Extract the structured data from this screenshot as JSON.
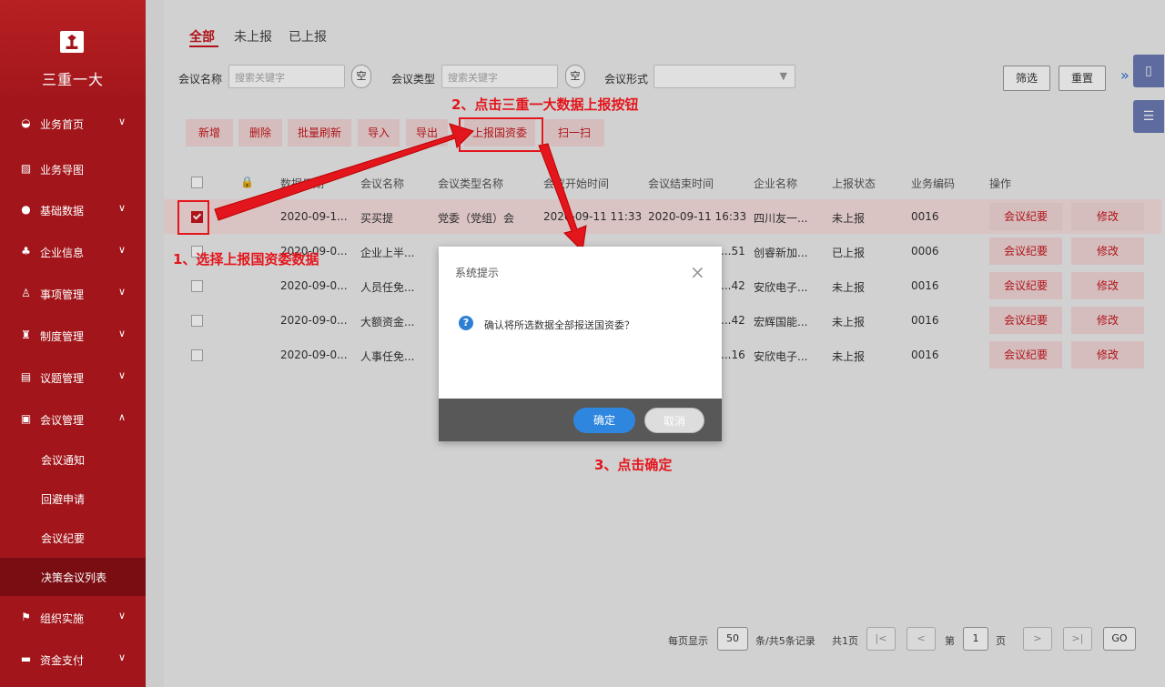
{
  "sidebar": {
    "logo_text": "三重一大",
    "items": [
      {
        "label": "业务首页",
        "chevron": "∨"
      },
      {
        "label": "业务导图",
        "chevron": ""
      },
      {
        "label": "基础数据",
        "chevron": "∨"
      },
      {
        "label": "企业信息",
        "chevron": "∨"
      },
      {
        "label": "事项管理",
        "chevron": "∨"
      },
      {
        "label": "制度管理",
        "chevron": "∨"
      },
      {
        "label": "议题管理",
        "chevron": "∨"
      },
      {
        "label": "会议管理",
        "chevron": "∧"
      },
      {
        "label": "组织实施",
        "chevron": "∨"
      },
      {
        "label": "资金支付",
        "chevron": "∨"
      }
    ],
    "subitems": [
      {
        "label": "会议通知"
      },
      {
        "label": "回避申请"
      },
      {
        "label": "会议纪要"
      },
      {
        "label": "决策会议列表"
      }
    ]
  },
  "tabs": [
    {
      "label": "全部"
    },
    {
      "label": "未上报"
    },
    {
      "label": "已上报"
    }
  ],
  "filters": {
    "meeting_name_label": "会议名称",
    "meeting_name_placeholder": "搜索关键字",
    "meeting_type_label": "会议类型",
    "meeting_type_placeholder": "搜索关键字",
    "meeting_form_label": "会议形式",
    "clear_label": "空",
    "filter_button": "筛选",
    "reset_button": "重置",
    "expand_icon": "»"
  },
  "actions": [
    "新增",
    "删除",
    "批量刷新",
    "导入",
    "导出",
    "上报国资委",
    "扫一扫"
  ],
  "table": {
    "headers": [
      "数据日期",
      "会议名称",
      "会议类型名称",
      "会议开始时间",
      "会议结束时间",
      "企业名称",
      "上报状态",
      "业务编码",
      "操作"
    ],
    "rows": [
      {
        "date": "2020-09-1...",
        "name": "买买提",
        "type": "党委（党组）会",
        "start": "2020-09-11 11:33",
        "end": "2020-09-11 16:33",
        "company": "四川友一...",
        "status": "未上报",
        "code": "0016",
        "checked": true
      },
      {
        "date": "2020-09-0...",
        "name": "企业上半...",
        "type": "",
        "start": "",
        "end": "...51",
        "company": "创睿新加...",
        "status": "已上报",
        "code": "0006",
        "checked": false
      },
      {
        "date": "2020-09-0...",
        "name": "人员任免...",
        "type": "",
        "start": "",
        "end": "...42",
        "company": "安欣电子...",
        "status": "未上报",
        "code": "0016",
        "checked": false
      },
      {
        "date": "2020-09-0...",
        "name": "大额资金...",
        "type": "",
        "start": "",
        "end": "...42",
        "company": "宏辉国能...",
        "status": "未上报",
        "code": "0016",
        "checked": false
      },
      {
        "date": "2020-09-0...",
        "name": "人事任免...",
        "type": "",
        "start": "",
        "end": "...16",
        "company": "安欣电子...",
        "status": "未上报",
        "code": "0016",
        "checked": false
      }
    ],
    "row_actions": [
      "会议纪要",
      "修改"
    ]
  },
  "dialog": {
    "title": "系统提示",
    "message": "确认将所选数据全部报送国资委？",
    "ok": "确定",
    "cancel": "取消",
    "close": "×"
  },
  "annotations": {
    "step1": "1、选择上报国资委数据",
    "step2": "2、点击三重一大数据上报按钮",
    "step3": "3、点击确定"
  },
  "pagination": {
    "per_page_label": "每页显示",
    "per_page": "50",
    "records": "条/共5条记录",
    "total_pages": "共1页",
    "first": "|<",
    "prev": "<",
    "page_prefix": "第",
    "page": "1",
    "page_suffix": "页",
    "next": ">",
    "last": ">|",
    "go": "GO"
  },
  "colors": {
    "brand": "#a2161b",
    "accent": "#c8161d",
    "annotation": "#e3161d",
    "primary_button": "#2e86de"
  }
}
